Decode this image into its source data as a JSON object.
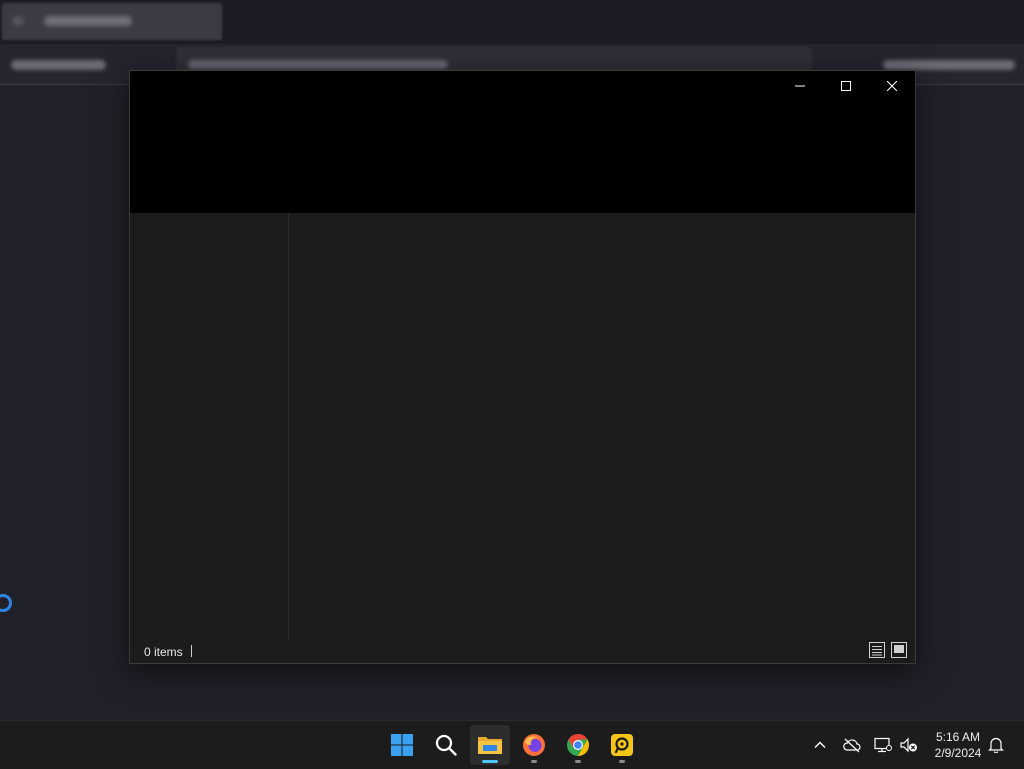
{
  "explorer": {
    "status_items": "0 items",
    "caption": {
      "minimize_icon": "minimize-icon",
      "maximize_icon": "maximize-icon",
      "close_icon": "close-icon"
    },
    "views": [
      "details-view-icon",
      "large-icons-view-icon"
    ]
  },
  "taskbar": {
    "apps": [
      {
        "name": "start",
        "icon": "windows-logo-icon"
      },
      {
        "name": "search",
        "icon": "search-icon"
      },
      {
        "name": "file-explorer",
        "icon": "folder-icon",
        "active": true
      },
      {
        "name": "firefox",
        "icon": "firefox-icon",
        "running": true
      },
      {
        "name": "chrome",
        "icon": "chrome-icon",
        "running": true
      },
      {
        "name": "app",
        "icon": "yellow-app-icon",
        "running": true
      }
    ],
    "tray": [
      "chevron-up-icon",
      "cloud-offline-icon",
      "network-icon",
      "volume-muted-icon",
      "notification-bell-icon"
    ],
    "clock": {
      "time": "5:16 AM",
      "date": "2/9/2024"
    }
  },
  "colors": {
    "accent": "#4cc2ff",
    "window_bg": "#1c1c1c",
    "header_bg": "#000000",
    "taskbar_bg": "#1c1c1c",
    "desktop_bg": "#202129"
  }
}
